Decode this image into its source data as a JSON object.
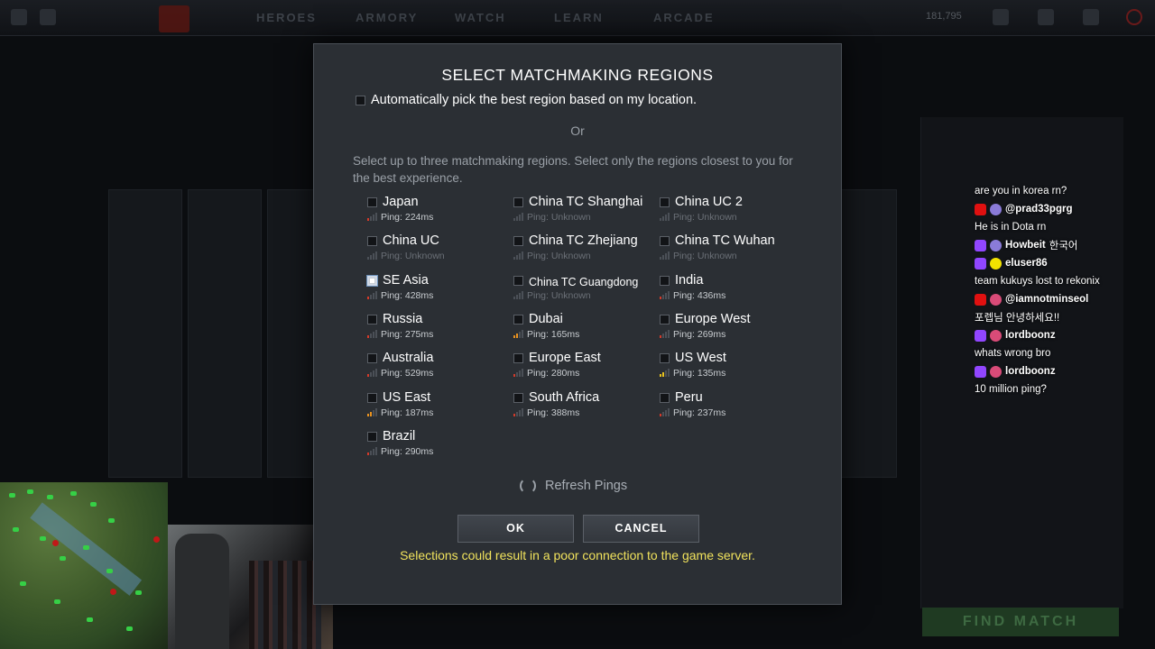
{
  "modal": {
    "title": "SELECT MATCHMAKING REGIONS",
    "auto_pick_label": "Automatically pick the best region based on my location.",
    "or_text": "Or",
    "description": "Select up to three matchmaking regions. Select only the regions closest to you for the best experience.",
    "regions": [
      {
        "name": "Japan",
        "ping": "Ping: 224ms",
        "checked": false,
        "signal": "red"
      },
      {
        "name": "China TC Shanghai",
        "ping": "Ping: Unknown",
        "checked": false,
        "signal": "none"
      },
      {
        "name": "China UC 2",
        "ping": "Ping: Unknown",
        "checked": false,
        "signal": "none"
      },
      {
        "name": "China UC",
        "ping": "Ping: Unknown",
        "checked": false,
        "signal": "none"
      },
      {
        "name": "China TC Zhejiang",
        "ping": "Ping: Unknown",
        "checked": false,
        "signal": "none"
      },
      {
        "name": "China TC Wuhan",
        "ping": "Ping: Unknown",
        "checked": false,
        "signal": "none"
      },
      {
        "name": "SE Asia",
        "ping": "Ping: 428ms",
        "checked": true,
        "signal": "red"
      },
      {
        "name": "China TC Guangdong",
        "ping": "Ping: Unknown",
        "checked": false,
        "signal": "none"
      },
      {
        "name": "India",
        "ping": "Ping: 436ms",
        "checked": false,
        "signal": "red"
      },
      {
        "name": "Russia",
        "ping": "Ping: 275ms",
        "checked": false,
        "signal": "red"
      },
      {
        "name": "Dubai",
        "ping": "Ping: 165ms",
        "checked": false,
        "signal": "orange"
      },
      {
        "name": "Europe West",
        "ping": "Ping: 269ms",
        "checked": false,
        "signal": "red"
      },
      {
        "name": "Australia",
        "ping": "Ping: 529ms",
        "checked": false,
        "signal": "red"
      },
      {
        "name": "Europe East",
        "ping": "Ping: 280ms",
        "checked": false,
        "signal": "red"
      },
      {
        "name": "US West",
        "ping": "Ping: 135ms",
        "checked": false,
        "signal": "yellow"
      },
      {
        "name": "US East",
        "ping": "Ping: 187ms",
        "checked": false,
        "signal": "orange"
      },
      {
        "name": "South Africa",
        "ping": "Ping: 388ms",
        "checked": false,
        "signal": "red"
      },
      {
        "name": "Peru",
        "ping": "Ping: 237ms",
        "checked": false,
        "signal": "red"
      },
      {
        "name": "Brazil",
        "ping": "Ping: 290ms",
        "checked": false,
        "signal": "red"
      }
    ],
    "refresh_label": "Refresh Pings",
    "ok_label": "OK",
    "cancel_label": "CANCEL",
    "warning": "Selections could result in a poor connection to the game server."
  },
  "background": {
    "nav": [
      "HEROES",
      "ARMORY",
      "WATCH",
      "LEARN",
      "ARCADE"
    ],
    "coins": "181,795",
    "find_match_label": "FIND MATCH"
  },
  "chat": [
    {
      "type": "text",
      "text": "are you in korea rn?"
    },
    {
      "type": "user",
      "platform": "yt",
      "avatar": "av",
      "name": "@prad33pgrg"
    },
    {
      "type": "text",
      "text": "He is in Dota rn"
    },
    {
      "type": "user",
      "platform": "tw",
      "avatar": "av",
      "name": "Howbeit",
      "extra": "한국어"
    },
    {
      "type": "user",
      "platform": "tw",
      "avatar": "av3",
      "name": "eluser86"
    },
    {
      "type": "text",
      "text": "team kukuys lost to rekonix"
    },
    {
      "type": "user",
      "platform": "yt",
      "avatar": "av2",
      "name": "@iamnotminseol"
    },
    {
      "type": "text",
      "text": "포렙님 안녕하세요!!"
    },
    {
      "type": "user",
      "platform": "tw",
      "avatar": "av2",
      "name": "lordboonz"
    },
    {
      "type": "text",
      "text": "whats wrong bro"
    },
    {
      "type": "user",
      "platform": "tw",
      "avatar": "av2",
      "name": "lordboonz"
    },
    {
      "type": "text",
      "text": "10 million ping?"
    }
  ]
}
